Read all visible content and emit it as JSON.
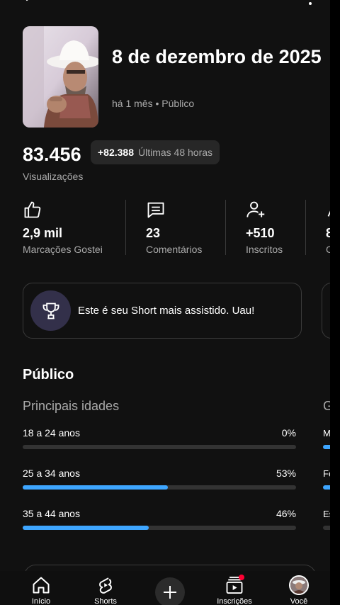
{
  "video": {
    "title": "8 de dezembro de 2025",
    "meta": "há 1 mês • Público"
  },
  "views": {
    "total": "83.456",
    "delta": "+82.388",
    "delta_period": "Últimas 48 horas",
    "label": "Visualizações"
  },
  "metrics": [
    {
      "icon": "thumbs-up-icon",
      "value": "2,9 mil",
      "label": "Marcações Gostei"
    },
    {
      "icon": "comment-icon",
      "value": "23",
      "label": "Comentários"
    },
    {
      "icon": "person-add-icon",
      "value": "+510",
      "label": "Inscritos"
    },
    {
      "icon": "share-icon",
      "value": "8",
      "label": "C"
    }
  ],
  "highlight": {
    "icon": "trophy-icon",
    "text": "Este é seu Short mais assistido. Uau!"
  },
  "audience": {
    "title": "Público",
    "ages_title": "Principais idades",
    "next_title_cut": "G",
    "ages": [
      {
        "label": "18 a 24 anos",
        "pct": "0%",
        "value": 0
      },
      {
        "label": "25 a 34 anos",
        "pct": "53%",
        "value": 53
      },
      {
        "label": "35 a 44 anos",
        "pct": "46%",
        "value": 46
      }
    ],
    "cut_labels": [
      "M",
      "Fe",
      "Es"
    ]
  },
  "nav": [
    {
      "label": "Início",
      "icon": "home-icon"
    },
    {
      "label": "Shorts",
      "icon": "shorts-icon"
    },
    {
      "label": "",
      "icon": "plus-icon"
    },
    {
      "label": "Inscrições",
      "icon": "subscriptions-icon"
    },
    {
      "label": "Você",
      "icon": "avatar"
    }
  ],
  "colors": {
    "background": "#111111",
    "accent": "#3ea6ff",
    "muted_text": "#aaaaaa",
    "notification": "#ff0033"
  }
}
